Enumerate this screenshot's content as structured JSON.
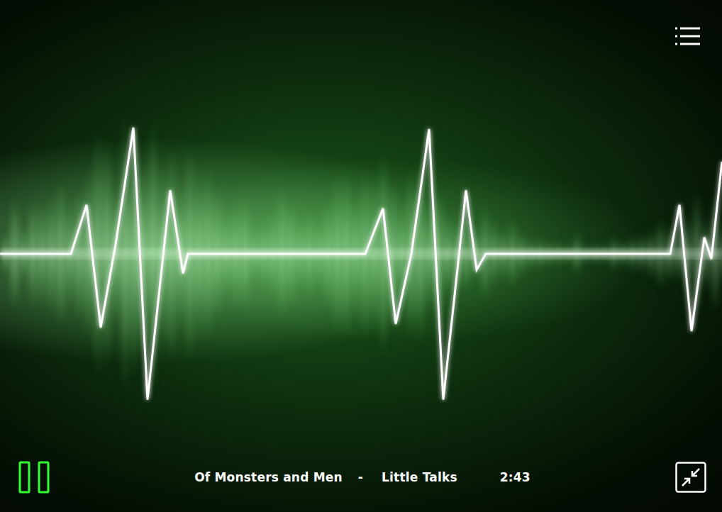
{
  "player": {
    "playing": true,
    "track": {
      "artist": "Of Monsters and Men",
      "separator": "-",
      "title": "Little Talks",
      "time": "2:43"
    }
  }
}
